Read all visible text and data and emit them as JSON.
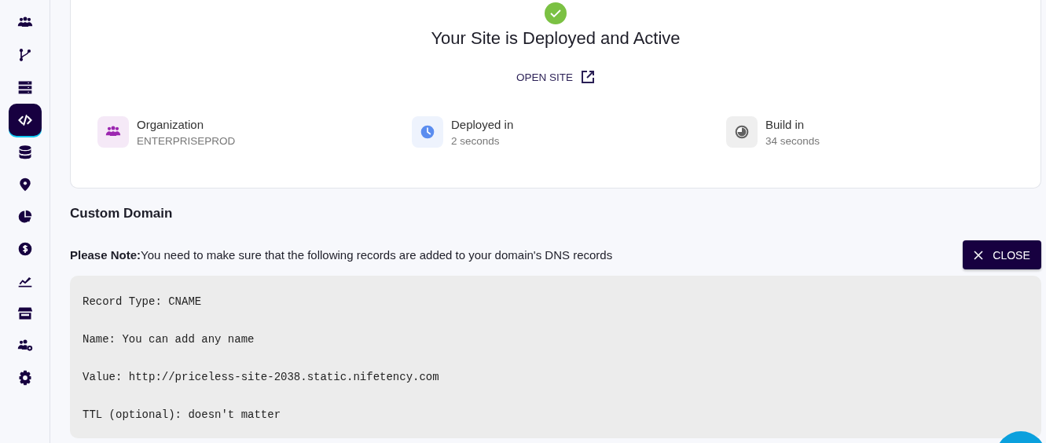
{
  "sidebar": {
    "items": [
      {
        "kind": "users",
        "selected": false
      },
      {
        "kind": "branch",
        "selected": false
      },
      {
        "kind": "server",
        "selected": false
      },
      {
        "kind": "code",
        "selected": true
      },
      {
        "kind": "database",
        "selected": false
      },
      {
        "kind": "pin",
        "selected": false
      },
      {
        "kind": "pie",
        "selected": false
      },
      {
        "kind": "dollar",
        "selected": false
      },
      {
        "kind": "chart",
        "selected": false
      },
      {
        "kind": "store",
        "selected": false
      },
      {
        "kind": "users-gear",
        "selected": false
      },
      {
        "kind": "gear",
        "selected": false
      }
    ]
  },
  "status": {
    "title": "Your Site is Deployed and Active",
    "link": "OPEN SITE"
  },
  "stats": [
    {
      "kind": "users",
      "color": "#9c27b0",
      "label": "Organization",
      "value": "ENTERPRISEPROD"
    },
    {
      "kind": "clock",
      "color": "#5b8def",
      "label": "Deployed in",
      "value": "2 seconds"
    },
    {
      "kind": "pie-clock",
      "color": "#616161",
      "label": "Build in",
      "value": "34 seconds"
    }
  ],
  "custom_domain": {
    "heading": "Custom Domain",
    "note": "**Please Note:**You need to make sure that the following records are added to your domain's DNS records",
    "close_button": "CLOSE",
    "records": [
      "Record Type: CNAME",
      "Name: You can add any name",
      "Value: http://priceless-site-2038.static.nifetency.com",
      "TTL (optional): doesn't matter"
    ]
  }
}
